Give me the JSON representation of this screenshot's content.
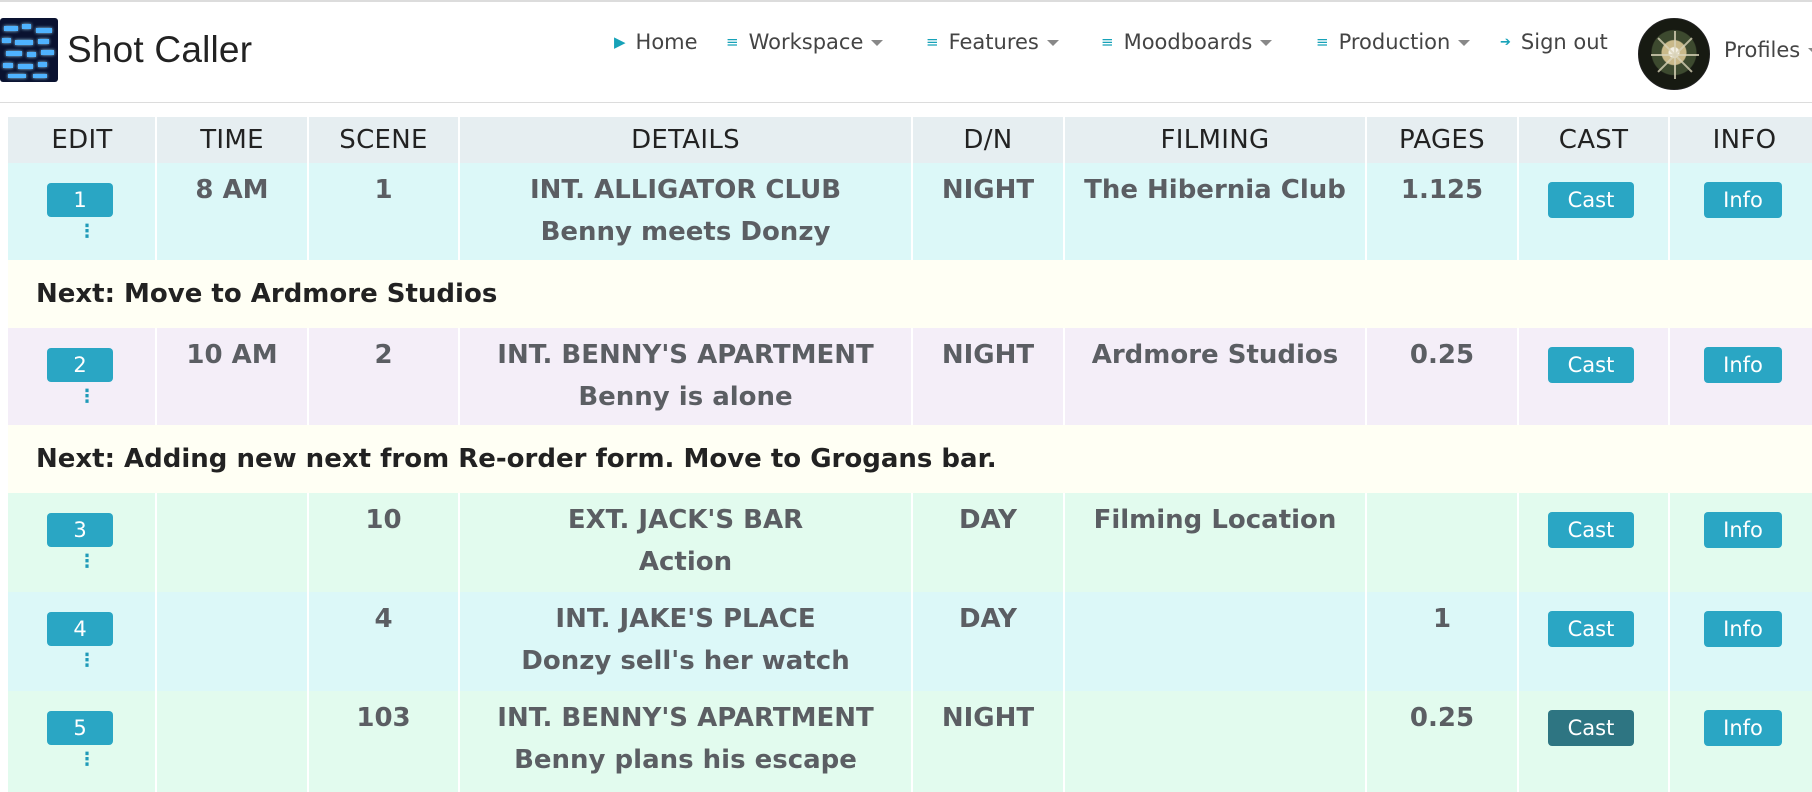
{
  "navbar": {
    "brand": "Shot Caller",
    "items": [
      {
        "label": "Home",
        "icon": "play-icon",
        "dropdown": false
      },
      {
        "label": "Workspace",
        "icon": "list-icon",
        "dropdown": true
      },
      {
        "label": "Features",
        "icon": "list-icon",
        "dropdown": true
      },
      {
        "label": "Moodboards",
        "icon": "list-icon",
        "dropdown": true
      },
      {
        "label": "Production",
        "icon": "list-icon",
        "dropdown": true
      },
      {
        "label": "Sign out",
        "icon": "sign-out-icon",
        "dropdown": false
      }
    ],
    "profiles_label": "Profiles"
  },
  "table": {
    "headers": [
      "EDIT",
      "TIME",
      "SCENE",
      "DETAILS",
      "D/N",
      "FILMING",
      "PAGES",
      "CAST",
      "INFO"
    ],
    "cast_label": "Cast",
    "info_label": "Info",
    "rows": [
      {
        "edit": "1",
        "time": "8 AM",
        "scene": "1",
        "heading": "INT. ALLIGATOR CLUB",
        "synopsis": "Benny meets Donzy",
        "dn": "NIGHT",
        "filming": "The Hibernia Club",
        "pages": "1.125"
      },
      {
        "edit": "2",
        "time": "10 AM",
        "scene": "2",
        "heading": "INT. BENNY'S APARTMENT",
        "synopsis": "Benny is alone",
        "dn": "NIGHT",
        "filming": "Ardmore Studios",
        "pages": "0.25"
      },
      {
        "edit": "3",
        "time": "",
        "scene": "10",
        "heading": "EXT. JACK'S BAR",
        "synopsis": "Action",
        "dn": "DAY",
        "filming": "Filming Location",
        "pages": ""
      },
      {
        "edit": "4",
        "time": "",
        "scene": "4",
        "heading": "INT. JAKE'S PLACE",
        "synopsis": "Donzy sell's her watch",
        "dn": "DAY",
        "filming": "",
        "pages": "1"
      },
      {
        "edit": "5",
        "time": "",
        "scene": "103",
        "heading": "INT. BENNY'S APARTMENT",
        "synopsis": "Benny plans his escape",
        "dn": "NIGHT",
        "filming": "",
        "pages": "0.25"
      }
    ],
    "next_notes": [
      "Next: Move to Ardmore Studios",
      "Next: Adding new next from Re-order form. Move to Grogans bar."
    ]
  },
  "colors": {
    "accent": "#2aa6c4",
    "header_bg": "#e6eef1",
    "row_cyan": "#dcf8f8",
    "row_lavender": "#f4eef8",
    "row_mint": "#e2fbee",
    "next_bg": "#fffff4",
    "cast_pressed": "#2e7582"
  }
}
